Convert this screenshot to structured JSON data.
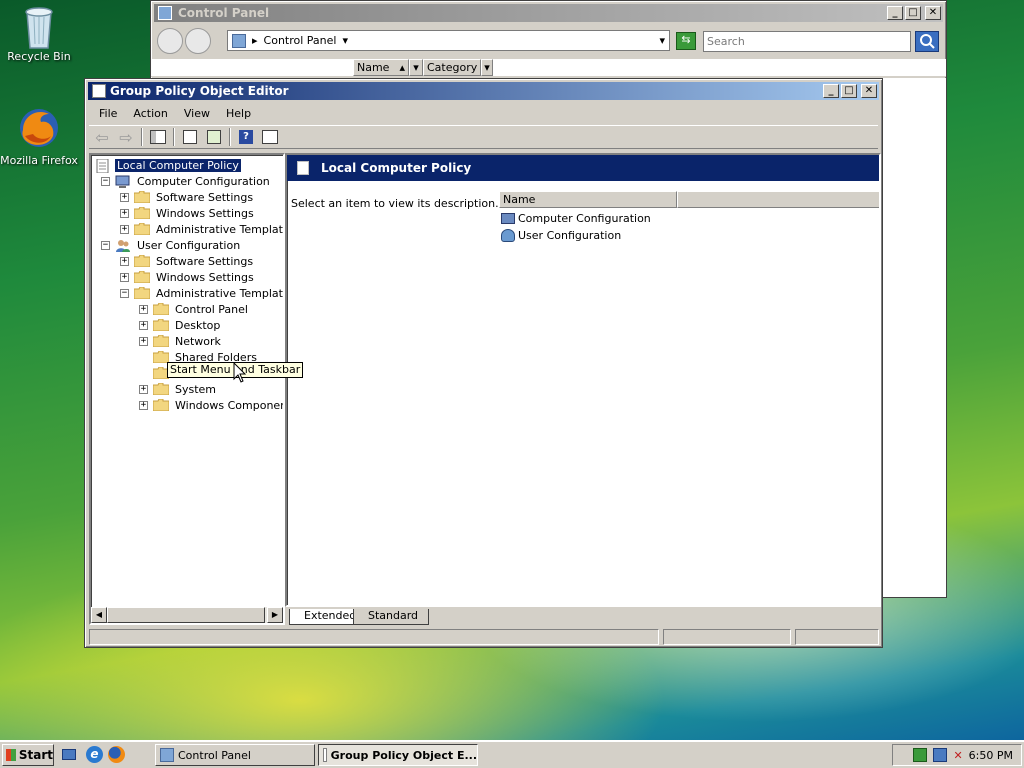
{
  "desktop": {
    "icons": [
      {
        "label": "Recycle Bin"
      },
      {
        "label": "Mozilla Firefox"
      }
    ]
  },
  "control_panel": {
    "title": "Control Panel",
    "address": "Control Panel",
    "search_placeholder": "Search",
    "columns": [
      "Name",
      "Category"
    ]
  },
  "gpo": {
    "title": "Group Policy Object Editor",
    "menu": [
      "File",
      "Action",
      "View",
      "Help"
    ],
    "tree": [
      {
        "label": "Local Computer Policy",
        "level": 0,
        "toggle": "",
        "selected": true
      },
      {
        "label": "Computer Configuration",
        "level": 1,
        "toggle": "−"
      },
      {
        "label": "Software Settings",
        "level": 2,
        "toggle": "+"
      },
      {
        "label": "Windows Settings",
        "level": 2,
        "toggle": "+"
      },
      {
        "label": "Administrative Templates",
        "level": 2,
        "toggle": "+"
      },
      {
        "label": "User Configuration",
        "level": 1,
        "toggle": "−"
      },
      {
        "label": "Software Settings",
        "level": 2,
        "toggle": "+"
      },
      {
        "label": "Windows Settings",
        "level": 2,
        "toggle": "+"
      },
      {
        "label": "Administrative Templates",
        "level": 2,
        "toggle": "−"
      },
      {
        "label": "Control Panel",
        "level": 3,
        "toggle": "+"
      },
      {
        "label": "Desktop",
        "level": 3,
        "toggle": "+"
      },
      {
        "label": "Network",
        "level": 3,
        "toggle": "+"
      },
      {
        "label": "Shared Folders",
        "level": 3,
        "toggle": ""
      },
      {
        "label": "Start Menu and Taskbar",
        "level": 3,
        "toggle": ""
      },
      {
        "label": "System",
        "level": 3,
        "toggle": "+"
      },
      {
        "label": "Windows Components",
        "level": 3,
        "toggle": "+"
      }
    ],
    "right_header": "Local Computer Policy",
    "description": "Select an item to view its description.",
    "list_column": "Name",
    "list_items": [
      "Computer Configuration",
      "User Configuration"
    ],
    "tabs": [
      "Extended",
      "Standard"
    ],
    "tooltip": "Start Menu and Taskbar"
  },
  "taskbar": {
    "start_label": "Start",
    "tasks": [
      "Control Panel",
      "Group Policy Object E..."
    ],
    "clock": "6:50 PM"
  }
}
